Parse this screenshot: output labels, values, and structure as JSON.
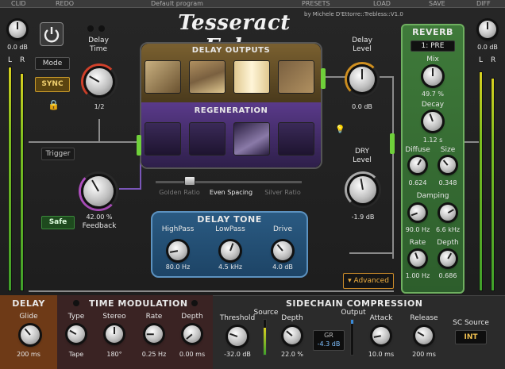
{
  "topbar": {
    "items": [
      "CLID",
      "REDO",
      "Default program",
      "PRESETS",
      "LOAD",
      "SAVE",
      "DIFF"
    ]
  },
  "header": {
    "title": "Tesseract Echo",
    "subtitle": "by Michele D'Ettorre::Trebless::V1.0"
  },
  "input": {
    "value": "0.0 dB",
    "left": "L",
    "right": "R"
  },
  "output": {
    "value": "0.0 dB",
    "left": "L",
    "right": "R"
  },
  "controls": {
    "mode": "Mode",
    "sync": "SYNC",
    "trigger": "Trigger",
    "safe": "Safe"
  },
  "delay_time": {
    "label": "Delay\nTime",
    "value": "1/2"
  },
  "feedback": {
    "label": "Feedback",
    "value": "42.00 %"
  },
  "delay_outputs": {
    "title": "DELAY OUTPUTS"
  },
  "regeneration": {
    "title": "REGENERATION"
  },
  "spacing": {
    "options": [
      "Golden Ratio",
      "Even Spacing",
      "Silver Ratio"
    ]
  },
  "delay_tone": {
    "title": "DELAY TONE",
    "knobs": [
      {
        "label": "HighPass",
        "value": "80.0 Hz"
      },
      {
        "label": "LowPass",
        "value": "4.5 kHz"
      },
      {
        "label": "Drive",
        "value": "4.0 dB"
      }
    ]
  },
  "delay_level": {
    "label": "Delay\nLevel",
    "value": "0.0 dB"
  },
  "dry_level": {
    "label": "DRY\nLevel",
    "value": "-1.9 dB"
  },
  "advanced": {
    "label": "▾ Advanced"
  },
  "reverb": {
    "title": "REVERB",
    "preset": "1: PRE",
    "mix": {
      "label": "Mix",
      "value": "49.7 %"
    },
    "decay": {
      "label": "Decay",
      "value": "1.12 s"
    },
    "diffuse": {
      "label": "Diffuse",
      "value": "0.624"
    },
    "size": {
      "label": "Size",
      "value": "0.348"
    },
    "damping": {
      "label": "Damping",
      "low": "90.0 Hz",
      "high": "6.6 kHz"
    },
    "rate": {
      "label": "Rate",
      "value": "1.00 Hz"
    },
    "depth": {
      "label": "Depth",
      "value": "0.686"
    }
  },
  "delay_section": {
    "title": "DELAY",
    "glide": {
      "label": "Glide",
      "value": "200 ms"
    }
  },
  "time_mod": {
    "title": "TIME MODULATION",
    "type": {
      "label": "Type",
      "value": "Tape"
    },
    "stereo": {
      "label": "Stereo",
      "value": "180°"
    },
    "rate": {
      "label": "Rate",
      "value": "0.25 Hz"
    },
    "depth": {
      "label": "Depth",
      "value": "0.00 ms"
    }
  },
  "sidechain": {
    "title": "SIDECHAIN COMPRESSION",
    "threshold": {
      "label": "Threshold",
      "value": "-32.0 dB"
    },
    "source": "Source",
    "depth": {
      "label": "Depth",
      "value": "22.0 %"
    },
    "gr": {
      "label": "GR",
      "value": "-4.3 dB"
    },
    "output": "Output",
    "attack": {
      "label": "Attack",
      "value": "10.0 ms"
    },
    "release": {
      "label": "Release",
      "value": "200 ms"
    },
    "sc_source": {
      "label": "SC Source",
      "value": "INT"
    }
  }
}
